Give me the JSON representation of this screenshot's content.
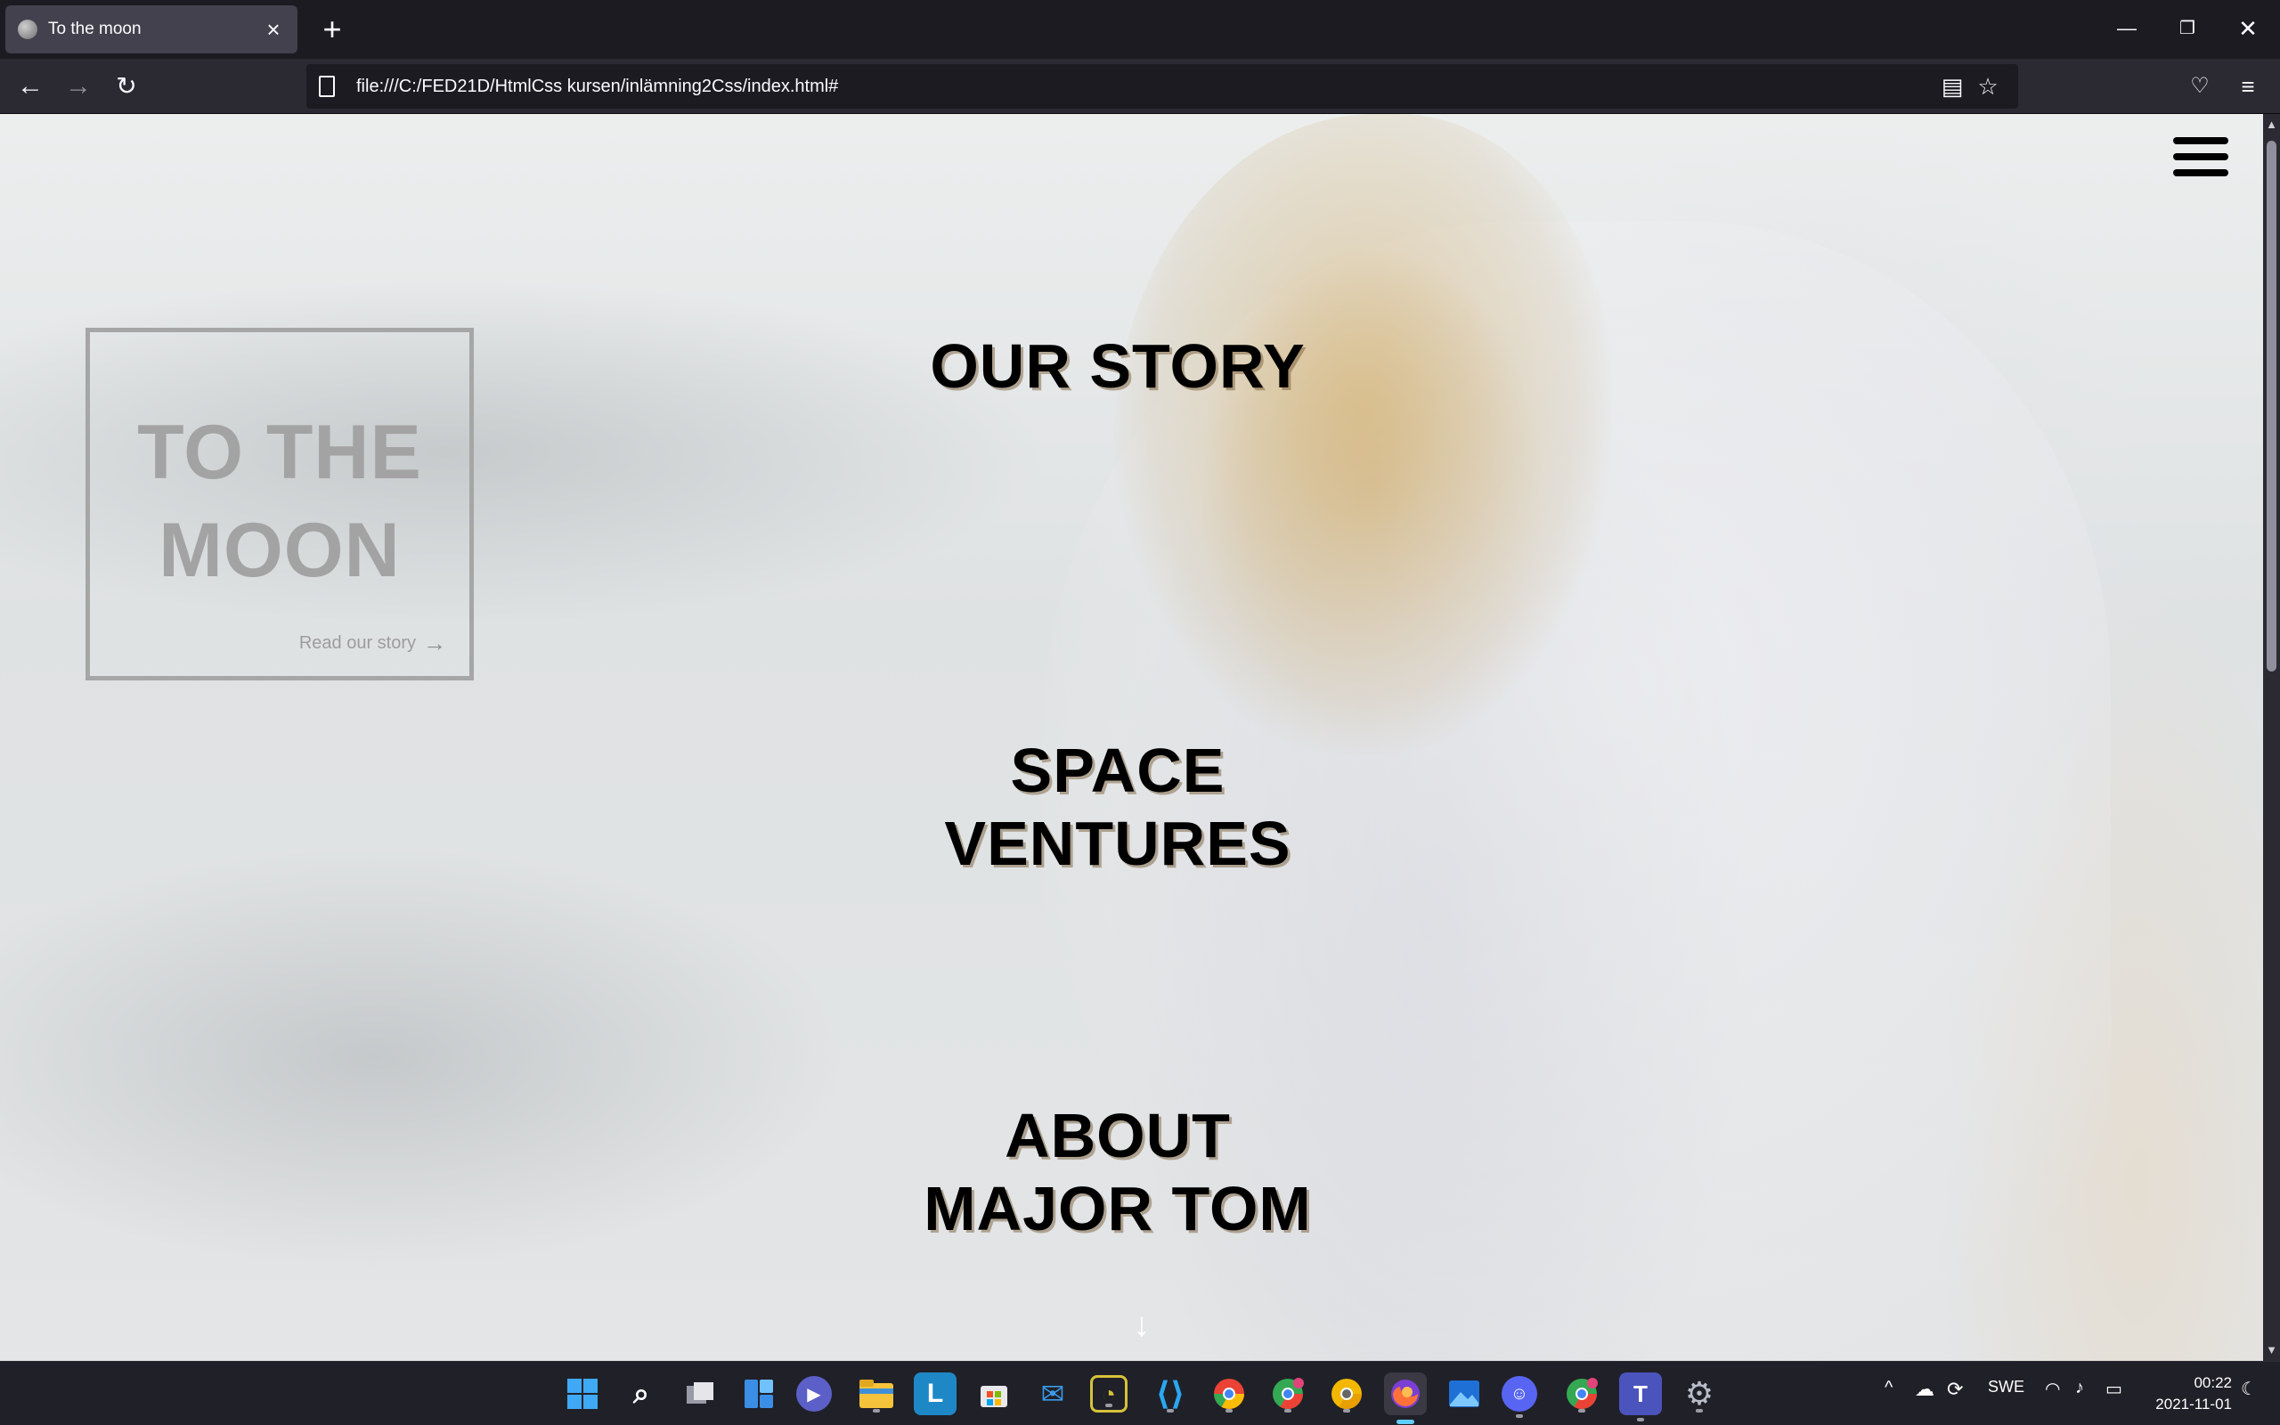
{
  "browser": {
    "tab_title": "To the moon",
    "url": "file:///C:/FED21D/HtmlCss kursen/inlämning2Css/index.html#"
  },
  "page": {
    "hero_title_line1": "TO THE",
    "hero_title_line2": "MOON",
    "hero_link": "Read our story",
    "menu": [
      {
        "line1": "OUR STORY",
        "line2": ""
      },
      {
        "line1": "SPACE",
        "line2": "VENTURES"
      },
      {
        "line1": "ABOUT",
        "line2": "MAJOR TOM"
      }
    ]
  },
  "taskbar": {
    "language": "SWE",
    "time": "00:22",
    "date": "2021-11-01",
    "apps": [
      "start-icon",
      "search-icon",
      "task-view-icon",
      "widgets-icon",
      "chat-icon",
      "file-explorer-icon",
      "app-l-icon",
      "store-icon",
      "mail-icon",
      "app-tracker-icon",
      "vscode-icon",
      "chrome-icon",
      "chrome-profile-icon",
      "chrome-canary-icon",
      "firefox-icon",
      "photos-icon",
      "discord-icon",
      "chrome-profile-2-icon",
      "teams-icon",
      "settings-icon"
    ]
  },
  "colors": {
    "chrome_bg": "#1c1b22",
    "toolbar_bg": "#2b2a33",
    "tab_active": "#42414d",
    "hero_gray": "#a3a3a3",
    "menu_text": "#000000"
  }
}
